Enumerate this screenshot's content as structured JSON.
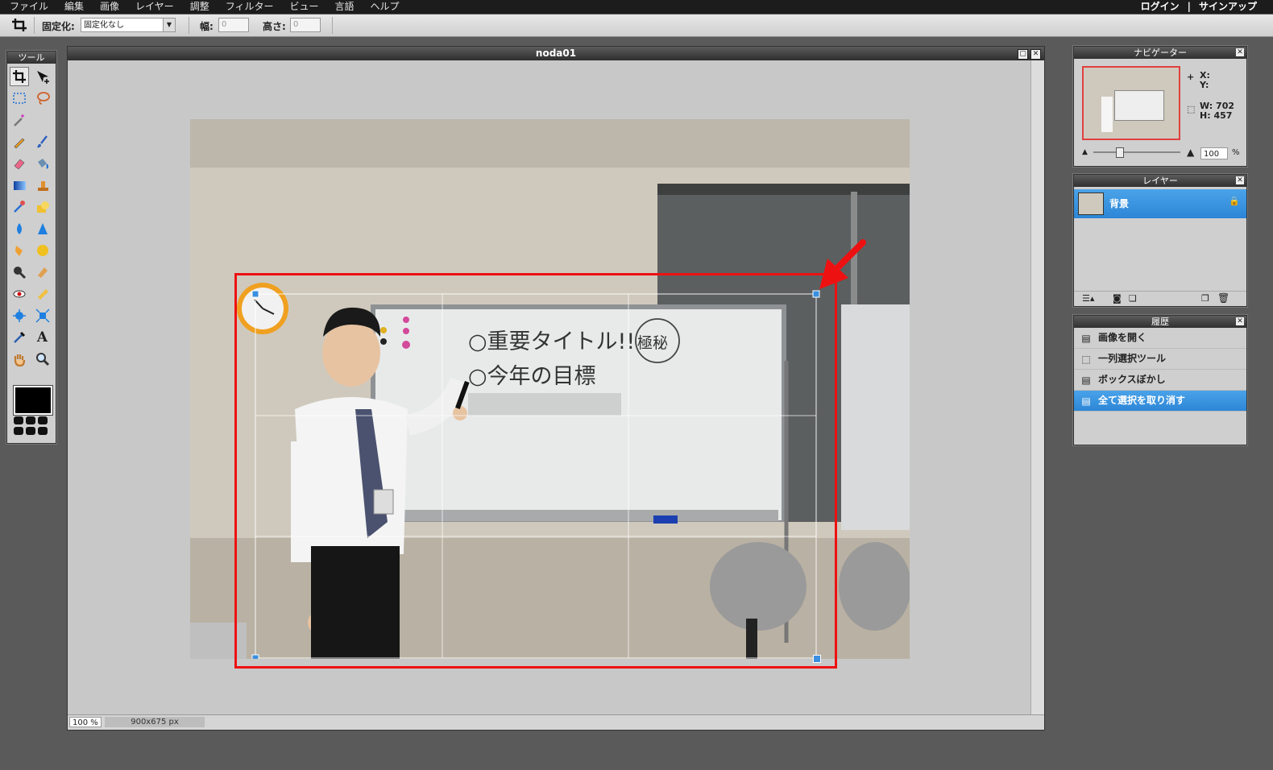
{
  "menubar": {
    "items": [
      "ファイル",
      "編集",
      "画像",
      "レイヤー",
      "調整",
      "フィルター",
      "ビュー",
      "言語",
      "ヘルプ"
    ],
    "login": "ログイン",
    "divider": "|",
    "signup": "サインアップ"
  },
  "toolbar": {
    "fix_label": "固定化:",
    "fix_value": "固定化なし",
    "width_label": "幅:",
    "width_value": "0",
    "height_label": "高さ:",
    "height_value": "0"
  },
  "tools_panel": {
    "title": "ツール"
  },
  "document": {
    "title": "noda01",
    "zoom": "100 %",
    "dimensions": "900x675 px"
  },
  "navigator": {
    "title": "ナビゲーター",
    "x_label": "X:",
    "y_label": "Y:",
    "w_label": "W:",
    "w_value": "702",
    "h_label": "H:",
    "h_value": "457",
    "zoom_value": "100",
    "zoom_unit": "%"
  },
  "layers": {
    "title": "レイヤー",
    "items": [
      {
        "name": "背景"
      }
    ]
  },
  "history": {
    "title": "履歴",
    "items": [
      "画像を開く",
      "一列選択ツール",
      "ボックスぼかし",
      "全て選択を取り消す"
    ],
    "selected_index": 3
  },
  "photo": {
    "whiteboard_line1": "○重要タイトル!!",
    "whiteboard_stamp": "極秘",
    "whiteboard_line2": "○今年の目標"
  },
  "colors": {
    "accent": "#2c86d6",
    "annotation": "#ee1111",
    "crop_handle": "#3a8fe0"
  }
}
